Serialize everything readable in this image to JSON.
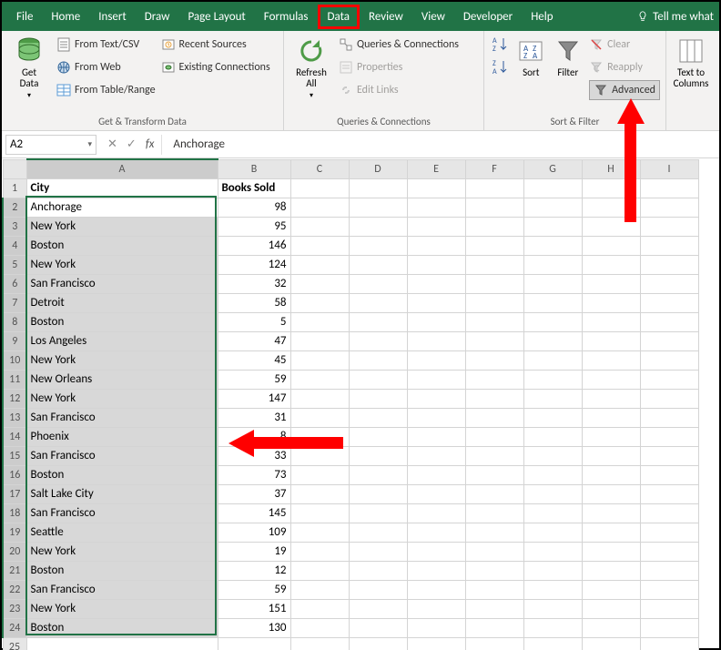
{
  "tabs": [
    "File",
    "Home",
    "Insert",
    "Draw",
    "Page Layout",
    "Formulas",
    "Data",
    "Review",
    "View",
    "Developer",
    "Help"
  ],
  "active_tab_index": 6,
  "tell_me": "Tell me what",
  "ribbon": {
    "get_data": "Get\nData",
    "from_text": "From Text/CSV",
    "from_web": "From Web",
    "from_table": "From Table/Range",
    "recent": "Recent Sources",
    "existing": "Existing Connections",
    "group1": "Get & Transform Data",
    "refresh": "Refresh\nAll",
    "queries": "Queries & Connections",
    "properties": "Properties",
    "edit_links": "Edit Links",
    "group2": "Queries & Connections",
    "sort": "Sort",
    "filter": "Filter",
    "clear": "Clear",
    "reapply": "Reapply",
    "advanced": "Advanced",
    "group3": "Sort & Filter",
    "text_cols": "Text to\nColumns"
  },
  "name_box": "A2",
  "formula": "Anchorage",
  "columns": [
    "A",
    "B",
    "C",
    "D",
    "E",
    "F",
    "G",
    "H",
    "I"
  ],
  "headers": {
    "c1": "City",
    "c2": "Books Sold"
  },
  "rows": [
    {
      "n": 1,
      "city": "City",
      "books": "Books Sold",
      "hdr": true
    },
    {
      "n": 2,
      "city": "Anchorage",
      "books": 98,
      "active": true
    },
    {
      "n": 3,
      "city": "New York",
      "books": 95
    },
    {
      "n": 4,
      "city": "Boston",
      "books": 146
    },
    {
      "n": 5,
      "city": "New York",
      "books": 124
    },
    {
      "n": 6,
      "city": "San Francisco",
      "books": 32
    },
    {
      "n": 7,
      "city": "Detroit",
      "books": 58
    },
    {
      "n": 8,
      "city": "Boston",
      "books": 5
    },
    {
      "n": 9,
      "city": "Los Angeles",
      "books": 47
    },
    {
      "n": 10,
      "city": "New York",
      "books": 45
    },
    {
      "n": 11,
      "city": "New Orleans",
      "books": 59
    },
    {
      "n": 12,
      "city": "New York",
      "books": 147
    },
    {
      "n": 13,
      "city": "San Francisco",
      "books": 31
    },
    {
      "n": 14,
      "city": "Phoenix",
      "books": 8
    },
    {
      "n": 15,
      "city": "San Francisco",
      "books": 33
    },
    {
      "n": 16,
      "city": "Boston",
      "books": 73
    },
    {
      "n": 17,
      "city": "Salt Lake City",
      "books": 37
    },
    {
      "n": 18,
      "city": "San Francisco",
      "books": 145
    },
    {
      "n": 19,
      "city": "Seattle",
      "books": 109
    },
    {
      "n": 20,
      "city": "New York",
      "books": 19
    },
    {
      "n": 21,
      "city": "Boston",
      "books": 12
    },
    {
      "n": 22,
      "city": "San Francisco",
      "books": 59
    },
    {
      "n": 23,
      "city": "New York",
      "books": 151
    },
    {
      "n": 24,
      "city": "Boston",
      "books": 130
    },
    {
      "n": 25,
      "city": "",
      "books": ""
    }
  ]
}
